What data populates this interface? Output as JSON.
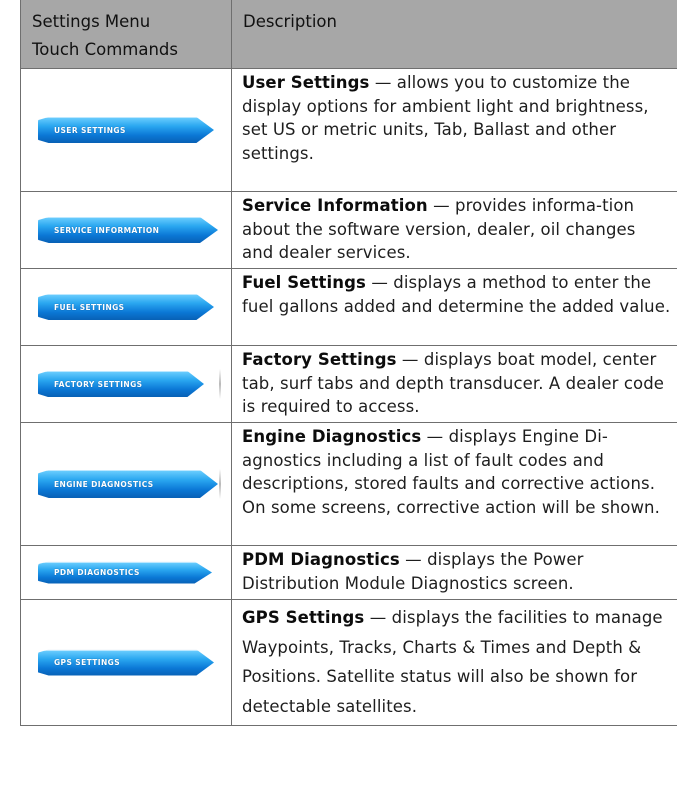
{
  "header": {
    "col1_line1": "Settings Menu",
    "col1_line2": "Touch Commands",
    "col2": "Description"
  },
  "rows": [
    {
      "button_label": "USER SETTINGS",
      "title": "User Settings",
      "text": " — allows you to customize the display options for ambient light and brightness, set US or metric units, Tab, Ballast and other settings."
    },
    {
      "button_label": "SERVICE INFORMATION",
      "title": "Service Information",
      "text": " — provides informa-tion about the software version, dealer, oil changes and dealer services."
    },
    {
      "button_label": "FUEL SETTINGS",
      "title": "Fuel Settings",
      "text": " — displays a method to enter the fuel gallons added and determine the added value."
    },
    {
      "button_label": "FACTORY SETTINGS",
      "title": "Factory Settings",
      "text": " — displays boat model, center tab, surf tabs and depth transducer. A dealer code is required to access."
    },
    {
      "button_label": "ENGINE DIAGNOSTICS",
      "title": "Engine Diagnostics",
      "text": " — displays Engine Di-agnostics including a list of fault codes and descriptions, stored faults and corrective actions. On some screens, corrective action will be shown."
    },
    {
      "button_label": "PDM DIAGNOSTICS",
      "title": "PDM Diagnostics",
      "text": " — displays the Power Distribution Module Diagnostics screen."
    },
    {
      "button_label": "GPS SETTINGS",
      "title": "GPS Settings",
      "text": " — displays the facilities to manage Waypoints, Tracks, Charts & Times and Depth & Positions.  Satellite status will also be shown for detectable satellites."
    }
  ],
  "colors": {
    "header_bg": "#a7a7a7",
    "border": "#6f6f6f",
    "button_blue": "#0b78d6"
  }
}
